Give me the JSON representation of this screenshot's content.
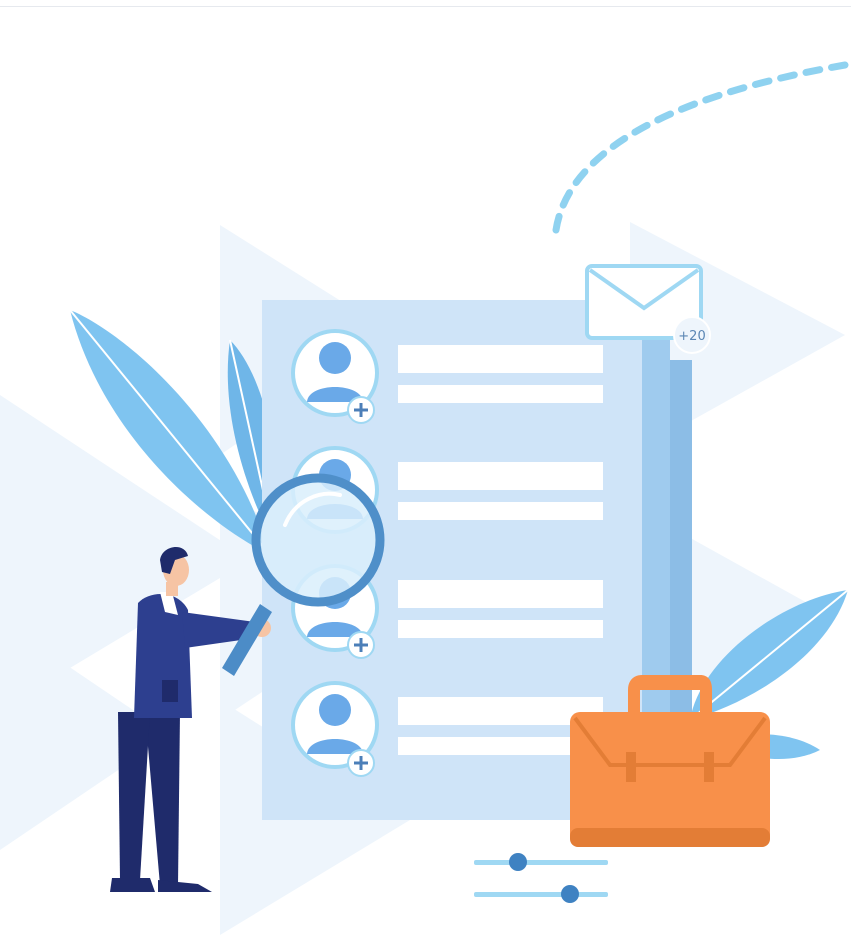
{
  "illustration": {
    "email_badge": "+20",
    "colors": {
      "light_shape": "#eef5fc",
      "document": "#cfe4f8",
      "avatar_blue": "#6aa9e8",
      "navy": "#2d3f8f",
      "suit_dark": "#1f2b6b",
      "bag_orange": "#f8904a",
      "bag_dark": "#e37d36",
      "leaf": "#7fc4f0",
      "dash": "#8fd2f0"
    },
    "icons": [
      "envelope-icon",
      "magnifying-glass-icon",
      "add-user-icon",
      "briefcase-icon",
      "slider-icon"
    ]
  }
}
